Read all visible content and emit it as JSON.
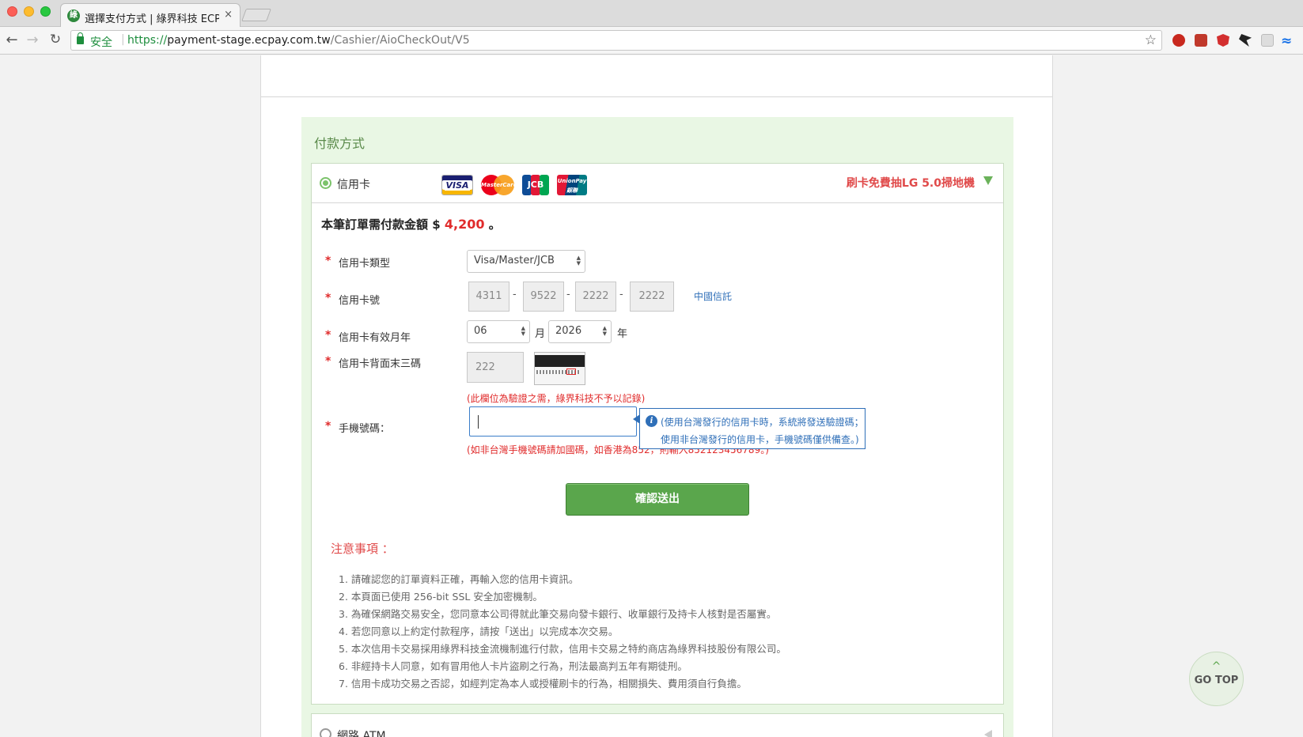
{
  "browser": {
    "tab_title": "選擇支付方式 | 綠界科技 ECPay",
    "tab_favicon": "綠",
    "tab_close": "×",
    "secure_label": "安全",
    "url_proto": "https://",
    "url_host": "payment-stage.ecpay.com.tw",
    "url_path": "/Cashier/AioCheckOut/V5",
    "icons": [
      "back-arrow-icon",
      "forward-arrow-icon",
      "reload-icon",
      "lock-icon",
      "star-icon",
      "adblock-extension-icon",
      "bookmark-extension-icon",
      "shield-extension-icon",
      "bat-extension-icon",
      "grey-extension-icon",
      "wave-extension-icon"
    ]
  },
  "payment": {
    "section_title": "付款方式",
    "credit_card": {
      "label": "信用卡",
      "logos": {
        "visa": "VISA",
        "mastercard": "MasterCard",
        "jcb": "JCB",
        "unionpay": "UnionPay 銀聯"
      },
      "promo": "刷卡免費抽LG 5.0掃地機",
      "amount_prefix": "本筆訂單需付款金額 $ ",
      "amount": "4,200",
      "amount_suffix": " 。",
      "fields": {
        "required_mark": "*",
        "card_type_label": "信用卡類型",
        "card_type_value": "Visa/Master/JCB",
        "card_number_label": "信用卡號",
        "card_number": [
          "4311",
          "9522",
          "2222",
          "2222"
        ],
        "number_separator": "-",
        "bank_name": "中國信託",
        "expiry_label": "信用卡有效月年",
        "expiry_month": "06",
        "month_unit": "月",
        "expiry_year": "2026",
        "year_unit": "年",
        "cvv_label": "信用卡背面末三碼",
        "cvv_value": "222",
        "cvv_note": "(此欄位為驗證之需，綠界科技不予以記錄)",
        "phone_label": "手機號碼：",
        "phone_value": "",
        "phone_note": "(如非台灣手機號碼請加國碼，如香港為852，則輸入852123456789。)",
        "tooltip_line1": "(使用台灣發行的信用卡時，系統將發送驗證碼；",
        "tooltip_line2": "使用非台灣發行的信用卡，手機號碼僅供備查。)",
        "tooltip_icon": "i"
      },
      "submit_label": "確認送出",
      "notice_title": "注意事項 ：",
      "notices": [
        "1. 請確認您的訂單資料正確，再輸入您的信用卡資訊。",
        "2. 本頁面已使用 256-bit SSL 安全加密機制。",
        "3. 為確保網路交易安全，您同意本公司得就此筆交易向發卡銀行、收單銀行及持卡人核對是否屬實。",
        "4. 若您同意以上約定付款程序，請按「送出」以完成本次交易。",
        "5. 本次信用卡交易採用綠界科技金流機制進行付款，信用卡交易之特約商店為綠界科技股份有限公司。",
        "6. 非經持卡人同意，如有冒用他人卡片盜刷之行為，刑法最高判五年有期徒刑。",
        "7. 信用卡成功交易之否認，如經判定為本人或授權刷卡的行為，相關損失、費用須自行負擔。"
      ]
    },
    "atm": {
      "label": "網路 ATM"
    }
  },
  "go_top": {
    "chevron": "^",
    "label": "GO TOP"
  },
  "colors": {
    "accent_green": "#5aa64c",
    "panel_bg": "#e9f7e4",
    "alert_red": "#e02b2b",
    "link_blue": "#2f6fb8"
  }
}
